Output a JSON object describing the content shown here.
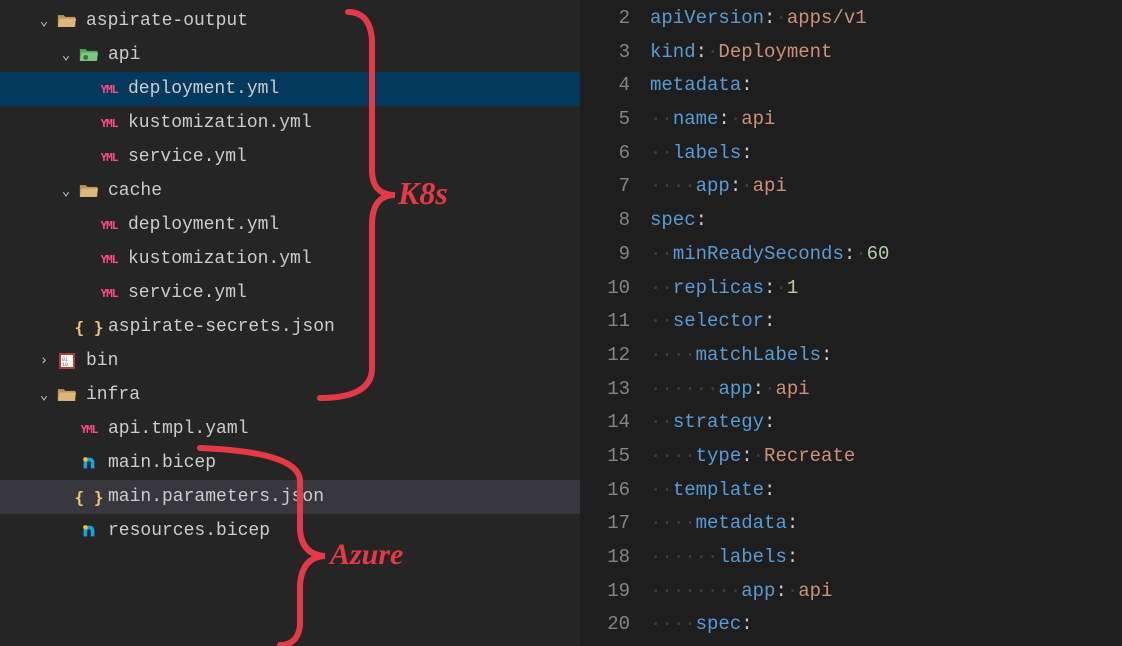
{
  "tree": {
    "aspirate_output": {
      "label": "aspirate-output"
    },
    "api": {
      "label": "api"
    },
    "api_deployment": {
      "label": "deployment.yml"
    },
    "api_kustomization": {
      "label": "kustomization.yml"
    },
    "api_service": {
      "label": "service.yml"
    },
    "cache": {
      "label": "cache"
    },
    "cache_deployment": {
      "label": "deployment.yml"
    },
    "cache_kustomization": {
      "label": "kustomization.yml"
    },
    "cache_service": {
      "label": "service.yml"
    },
    "aspirate_secrets": {
      "label": "aspirate-secrets.json"
    },
    "bin": {
      "label": "bin"
    },
    "infra": {
      "label": "infra"
    },
    "api_tmpl": {
      "label": "api.tmpl.yaml"
    },
    "main_bicep": {
      "label": "main.bicep"
    },
    "main_params": {
      "label": "main.parameters.json"
    },
    "resources_bicep": {
      "label": "resources.bicep"
    }
  },
  "annotations": {
    "k8s": "K8s",
    "azure": "Azure"
  },
  "code": {
    "lines": [
      {
        "n": 2,
        "indent": 0,
        "key": "apiVersion",
        "value": "apps/v1",
        "vtype": "string"
      },
      {
        "n": 3,
        "indent": 0,
        "key": "kind",
        "value": "Deployment",
        "vtype": "string"
      },
      {
        "n": 4,
        "indent": 0,
        "key": "metadata",
        "value": "",
        "vtype": "none"
      },
      {
        "n": 5,
        "indent": 1,
        "key": "name",
        "value": "api",
        "vtype": "string"
      },
      {
        "n": 6,
        "indent": 1,
        "key": "labels",
        "value": "",
        "vtype": "none"
      },
      {
        "n": 7,
        "indent": 2,
        "key": "app",
        "value": "api",
        "vtype": "string"
      },
      {
        "n": 8,
        "indent": 0,
        "key": "spec",
        "value": "",
        "vtype": "none"
      },
      {
        "n": 9,
        "indent": 1,
        "key": "minReadySeconds",
        "value": "60",
        "vtype": "number"
      },
      {
        "n": 10,
        "indent": 1,
        "key": "replicas",
        "value": "1",
        "vtype": "number"
      },
      {
        "n": 11,
        "indent": 1,
        "key": "selector",
        "value": "",
        "vtype": "none"
      },
      {
        "n": 12,
        "indent": 2,
        "key": "matchLabels",
        "value": "",
        "vtype": "none"
      },
      {
        "n": 13,
        "indent": 3,
        "key": "app",
        "value": "api",
        "vtype": "string"
      },
      {
        "n": 14,
        "indent": 1,
        "key": "strategy",
        "value": "",
        "vtype": "none"
      },
      {
        "n": 15,
        "indent": 2,
        "key": "type",
        "value": "Recreate",
        "vtype": "string"
      },
      {
        "n": 16,
        "indent": 1,
        "key": "template",
        "value": "",
        "vtype": "none"
      },
      {
        "n": 17,
        "indent": 2,
        "key": "metadata",
        "value": "",
        "vtype": "none"
      },
      {
        "n": 18,
        "indent": 3,
        "key": "labels",
        "value": "",
        "vtype": "none"
      },
      {
        "n": 19,
        "indent": 4,
        "key": "app",
        "value": "api",
        "vtype": "string"
      },
      {
        "n": 20,
        "indent": 2,
        "key": "spec",
        "value": "",
        "vtype": "none"
      }
    ]
  }
}
